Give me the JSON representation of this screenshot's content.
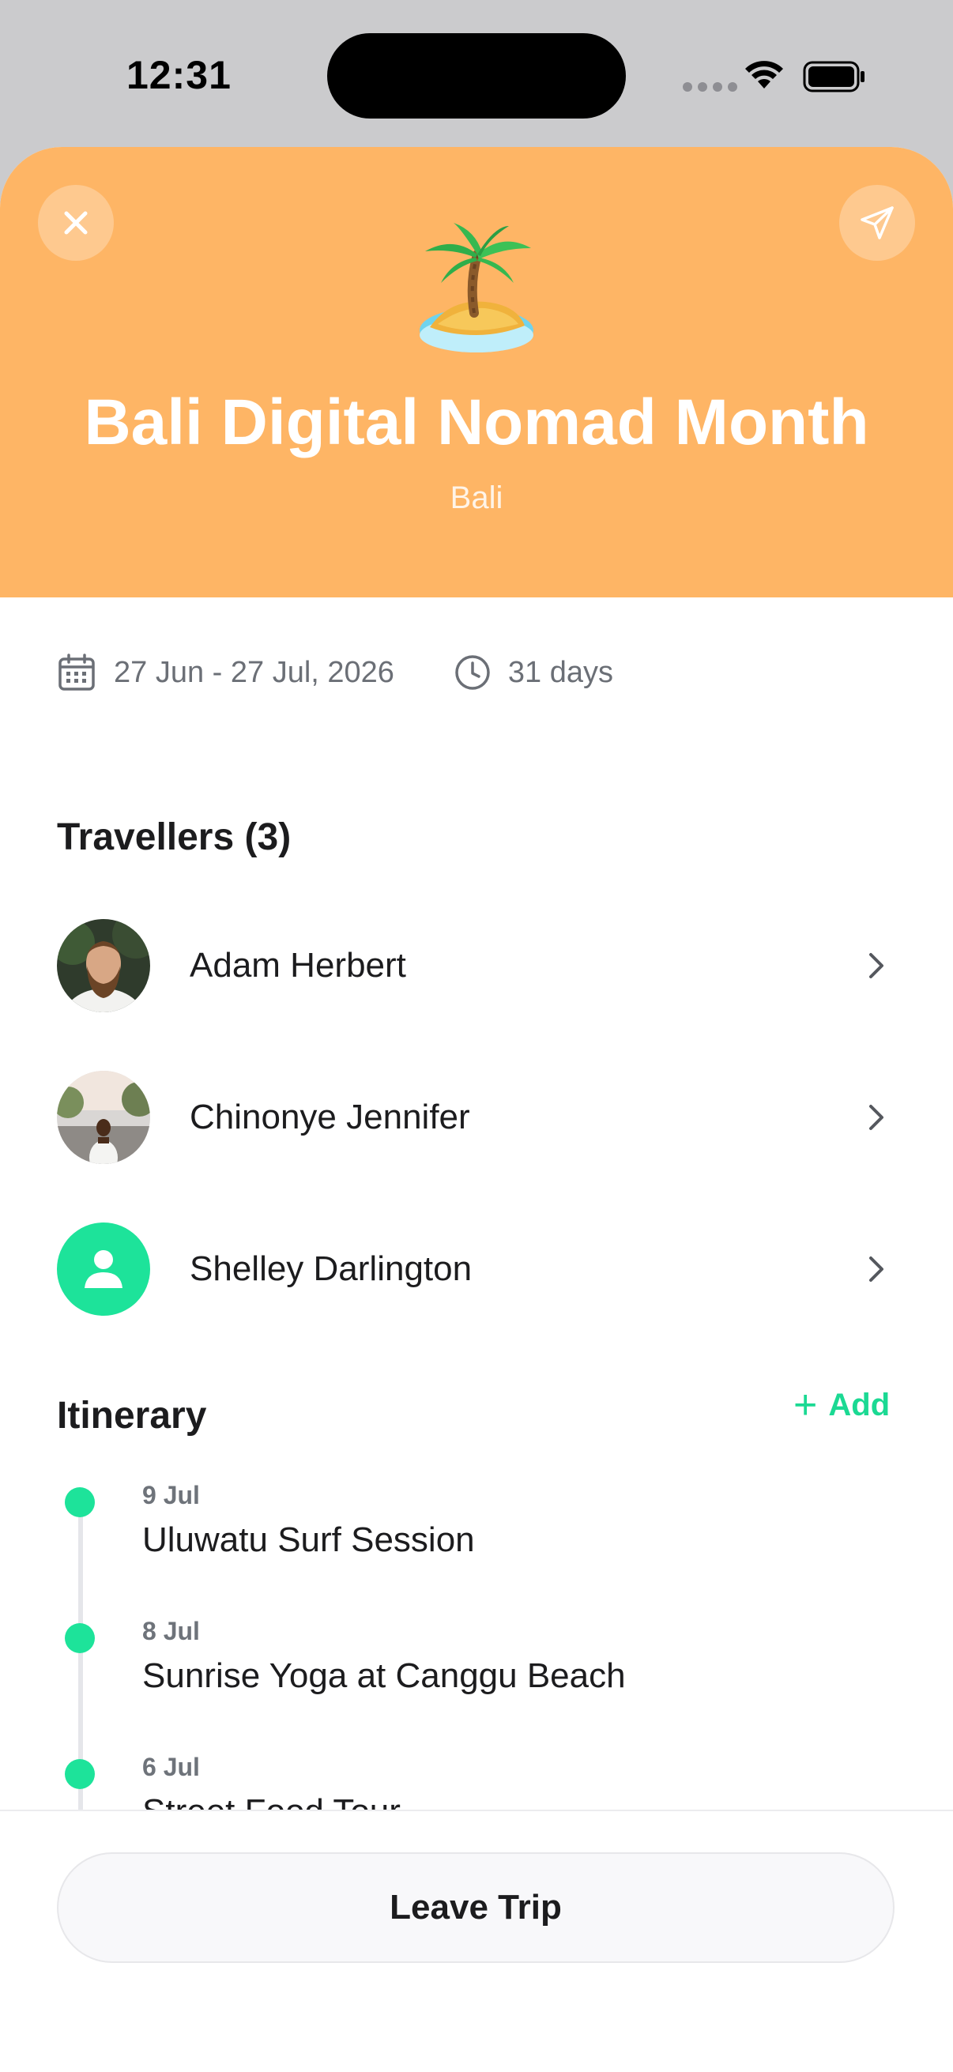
{
  "status_bar": {
    "time": "12:31"
  },
  "trip": {
    "emoji_icon": "desert-island-icon",
    "title": "Bali Digital Nomad Month",
    "location": "Bali",
    "hero_color": "#feb565",
    "dates": "27 Jun - 27 Jul, 2026",
    "duration": "31 days"
  },
  "travellers": {
    "heading": "Travellers (3)",
    "items": [
      {
        "name": "Adam Herbert"
      },
      {
        "name": "Chinonye Jennifer"
      },
      {
        "name": "Shelley Darlington"
      }
    ]
  },
  "itinerary": {
    "heading": "Itinerary",
    "add_label": "Add",
    "accent_color": "#1de39a",
    "items": [
      {
        "date": "9 Jul",
        "title": "Uluwatu Surf Session"
      },
      {
        "date": "8 Jul",
        "title": "Sunrise Yoga at Canggu Beach"
      },
      {
        "date": "6 Jul",
        "title": "Street Food Tour"
      }
    ]
  },
  "actions": {
    "leave_label": "Leave Trip"
  }
}
